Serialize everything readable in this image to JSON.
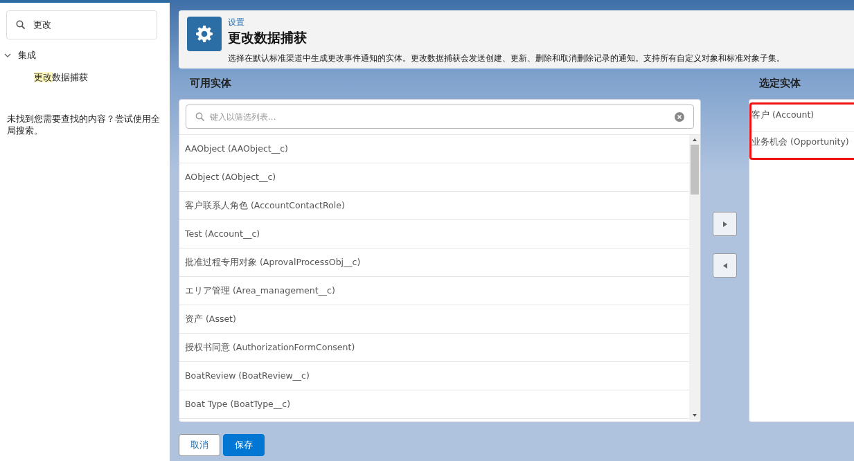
{
  "sidebar": {
    "search": {
      "value": "更改"
    },
    "tree": [
      {
        "label": "集成",
        "expanded": true,
        "children": [
          {
            "highlight": "更改",
            "rest": "数据捕获"
          }
        ]
      }
    ],
    "hint": "未找到您需要查找的内容？尝试使用全局搜索。"
  },
  "header": {
    "breadcrumb": "设置",
    "title": "更改数据捕获",
    "description": "选择在默认标准渠道中生成更改事件通知的实体。更改数据捕获会发送创建、更新、删除和取消删除记录的通知。支持所有自定义对象和标准对象子集。"
  },
  "available": {
    "label": "可用实体",
    "filter": {
      "placeholder": "键入以筛选列表..."
    },
    "items": [
      "AAObject (AAObject__c)",
      "AObject (AObject__c)",
      "客户联系人角色 (AccountContactRole)",
      "Test (Account__c)",
      "批准过程专用对象 (AprovalProcessObj__c)",
      "エリア管理 (Area_management__c)",
      "资产 (Asset)",
      "授权书同意 (AuthorizationFormConsent)",
      "BoatReview (BoatReview__c)",
      "Boat Type (BoatType__c)"
    ]
  },
  "move_buttons": [
    {
      "kind": "right"
    },
    {
      "kind": "left"
    }
  ],
  "selected": {
    "label": "选定实体",
    "highlighted": true,
    "items": [
      "客户 (Account)",
      "业务机会 (Opportunity)"
    ]
  },
  "buttons": [
    {
      "label": "取消",
      "kind": "neutral"
    },
    {
      "label": "保存",
      "kind": "brand"
    }
  ]
}
